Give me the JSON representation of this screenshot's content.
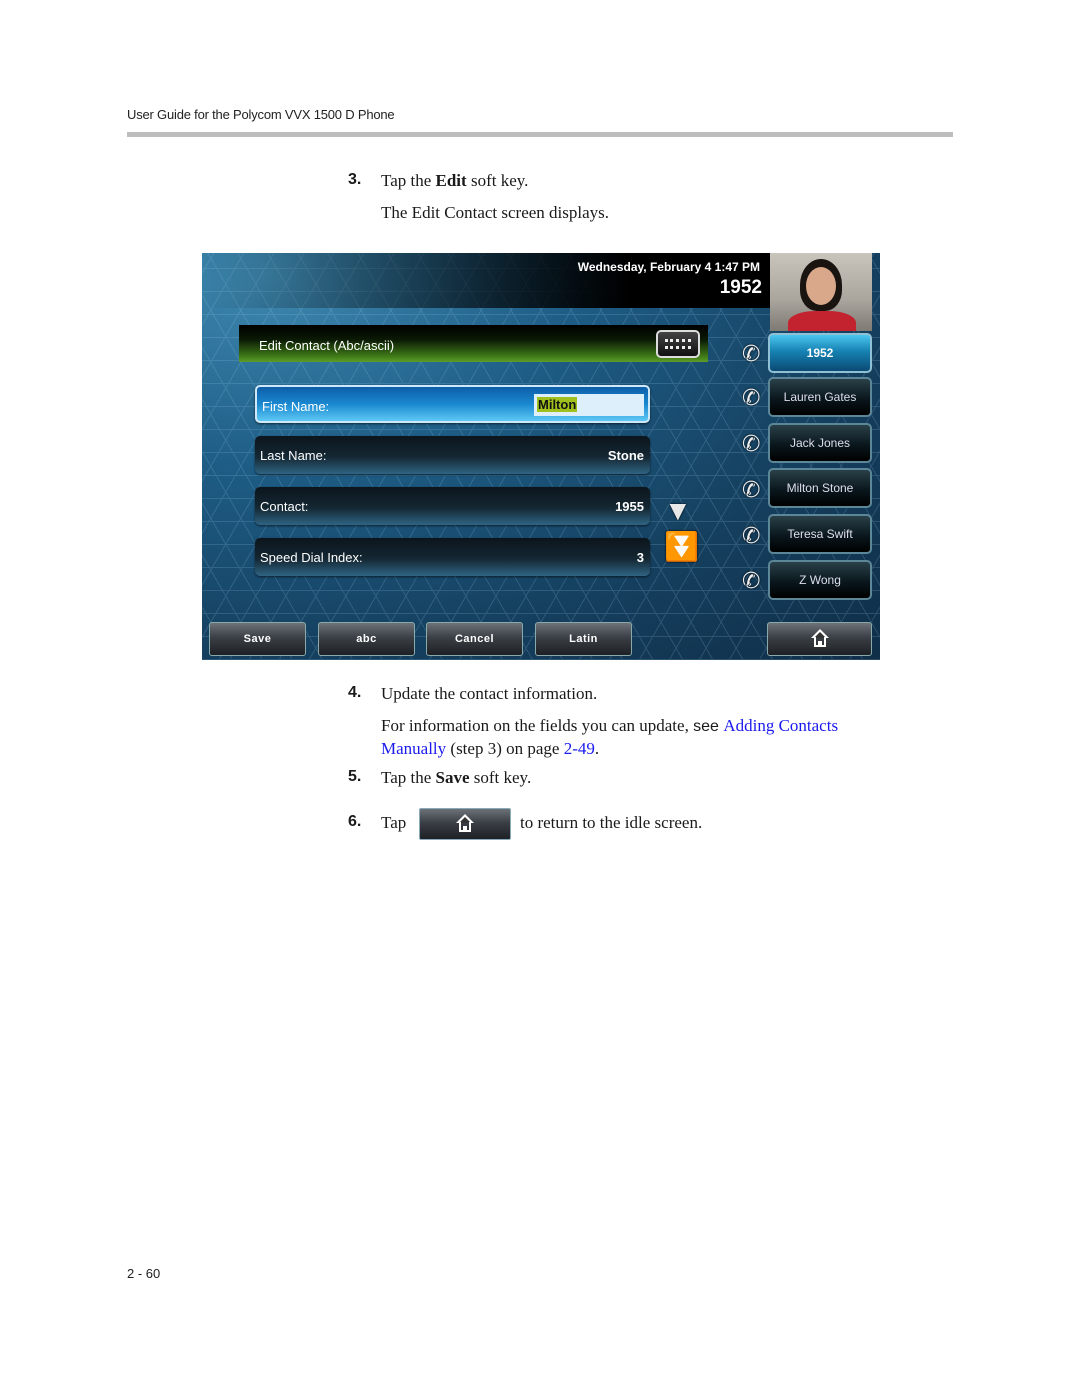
{
  "header": {
    "title": "User Guide for the Polycom VVX 1500 D Phone"
  },
  "steps": {
    "s3": {
      "num": "3.",
      "pre": "Tap the ",
      "key": "Edit",
      "post": " soft key.",
      "result": "The Edit Contact screen displays."
    },
    "s4": {
      "num": "4.",
      "text": "Update the contact information.",
      "info_pre": "For information on the fields you can update, ",
      "info_see": "see ",
      "link1": "Adding Contacts",
      "link1b": "Manually",
      "info_mid": " (step 3) on page ",
      "link2": "2-49",
      "info_end": "."
    },
    "s5": {
      "num": "5.",
      "pre": "Tap the ",
      "key": "Save",
      "post": " soft key."
    },
    "s6": {
      "num": "6.",
      "pre": "Tap",
      "post": "to return to the idle screen.",
      "button_icon": "home-icon"
    }
  },
  "screen": {
    "datetime": "Wednesday, February 4  1:47 PM",
    "line_number": "1952",
    "title": "Edit Contact (Abc/ascii)",
    "keyboard_icon": "keyboard-icon",
    "fields": [
      {
        "label": "First Name:",
        "value": "Milton",
        "active": true
      },
      {
        "label": "Last Name:",
        "value": "Stone"
      },
      {
        "label": "Contact:",
        "value": "1955"
      },
      {
        "label": "Speed Dial Index:",
        "value": "3"
      }
    ],
    "scroll_icons": [
      "arrow-down-icon",
      "double-arrow-down-icon"
    ],
    "line_keys": [
      {
        "label": "1952",
        "icon": "phone-registered-icon",
        "selected": true
      },
      {
        "label": "Lauren Gates",
        "icon": "speed-dial-icon"
      },
      {
        "label": "Jack Jones",
        "icon": "speed-dial-icon"
      },
      {
        "label": "Milton Stone",
        "icon": "speed-dial-icon"
      },
      {
        "label": "Teresa Swift",
        "icon": "speed-dial-icon"
      },
      {
        "label": "Z Wong",
        "icon": "speed-dial-icon"
      }
    ],
    "softkeys": [
      "Save",
      "abc",
      "Cancel",
      "Latin"
    ],
    "home_icon": "home-icon"
  },
  "footer": {
    "page": "2 - 60"
  }
}
